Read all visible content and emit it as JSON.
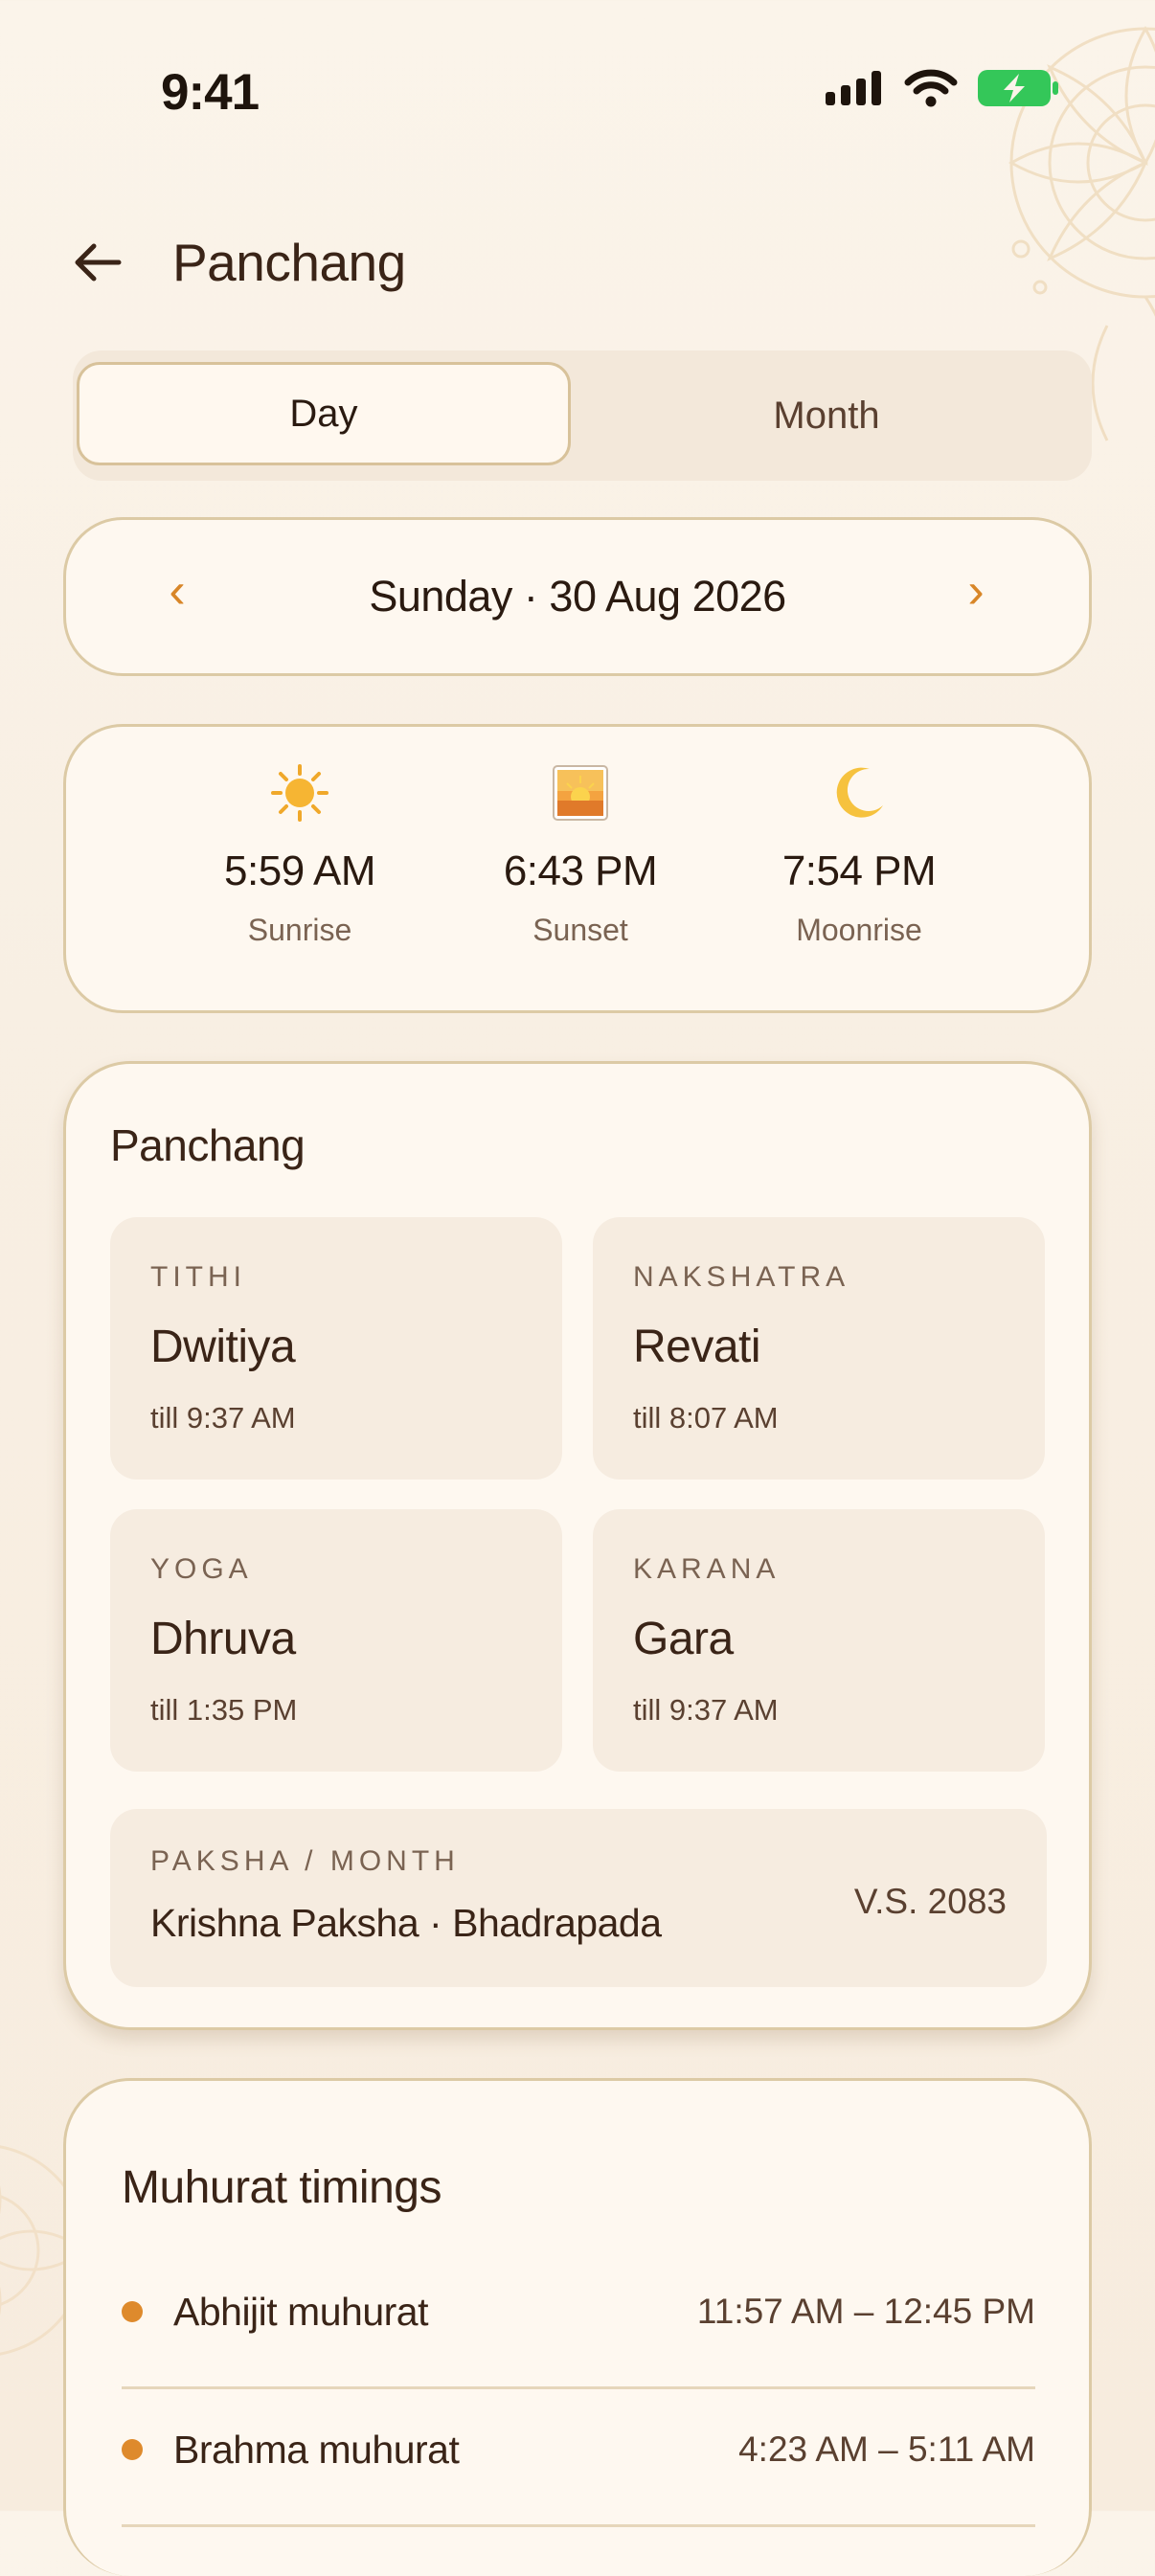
{
  "status_bar": {
    "time": "9:41"
  },
  "header": {
    "title": "Panchang"
  },
  "segmented": {
    "day": "Day",
    "month": "Month",
    "selected": "Day"
  },
  "date_nav": {
    "prev": "‹",
    "next": "›",
    "label": "Sunday · 30 Aug 2026"
  },
  "sun_times": [
    {
      "icon": "sun-icon",
      "time": "5:59 AM",
      "label": "Sunrise"
    },
    {
      "icon": "sunset-icon",
      "time": "6:43 PM",
      "label": "Sunset"
    },
    {
      "icon": "moon-icon",
      "time": "7:54 PM",
      "label": "Moonrise"
    }
  ],
  "panchang": {
    "title": "Panchang",
    "tiles": [
      {
        "caption": "TITHI",
        "value": "Dwitiya",
        "sub": "till 9:37 AM"
      },
      {
        "caption": "NAKSHATRA",
        "value": "Revati",
        "sub": "till 8:07 AM"
      },
      {
        "caption": "YOGA",
        "value": "Dhruva",
        "sub": "till 1:35 PM"
      },
      {
        "caption": "KARANA",
        "value": "Gara",
        "sub": "till 9:37 AM"
      }
    ],
    "paksha": {
      "caption": "PAKSHA / MONTH",
      "value": "Krishna Paksha · Bhadrapada",
      "year": "V.S. 2083"
    }
  },
  "muhurat": {
    "title": "Muhurat timings",
    "rows": [
      {
        "name": "Abhijit muhurat",
        "time": "11:57 AM – 12:45 PM"
      },
      {
        "name": "Brahma muhurat",
        "time": "4:23 AM – 5:11 AM"
      }
    ]
  },
  "colors": {
    "accent": "#de8a2c",
    "background": "#f9f0e4",
    "card": "#fef8f0",
    "tile": "#f6ece0",
    "text": "#3a2417",
    "battery": "#34c759"
  }
}
